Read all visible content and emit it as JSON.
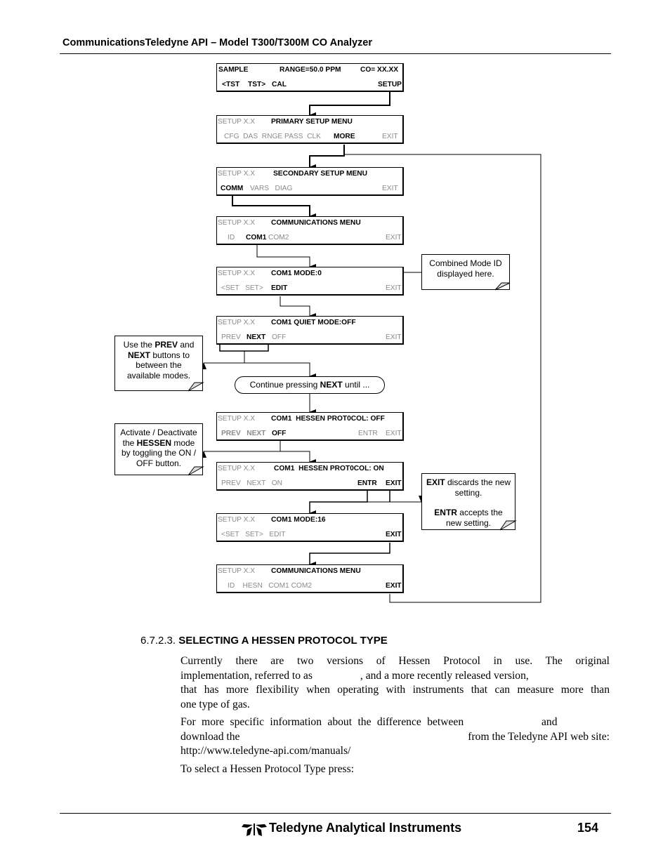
{
  "header": {
    "title": "CommunicationsTeledyne API – Model T300/T300M CO Analyzer"
  },
  "screens": [
    {
      "id": "sample",
      "line1": [
        {
          "t": "SAMPLE",
          "s": "b"
        },
        {
          "t": "RANGE=50.0 PPM",
          "s": "b"
        },
        {
          "t": "CO= XX.XX",
          "s": "b"
        }
      ],
      "line2": [
        {
          "t": "<TST",
          "s": "b"
        },
        {
          "t": "TST>",
          "s": "b"
        },
        {
          "t": "CAL",
          "s": "b"
        },
        {
          "t": "SETUP",
          "s": "b"
        }
      ]
    },
    {
      "id": "primary-setup",
      "line1": [
        {
          "t": "SETUP X.X",
          "s": "g"
        },
        {
          "t": "PRIMARY SETUP MENU",
          "s": "b"
        }
      ],
      "line2": [
        {
          "t": "CFG  DAS  RNGE PASS  CLK",
          "s": "g"
        },
        {
          "t": "MORE",
          "s": "b"
        },
        {
          "t": "EXIT",
          "s": "g"
        }
      ]
    },
    {
      "id": "secondary-setup",
      "line1": [
        {
          "t": "SETUP X.X",
          "s": "g"
        },
        {
          "t": "SECONDARY SETUP MENU",
          "s": "b"
        }
      ],
      "line2": [
        {
          "t": "COMM",
          "s": "b"
        },
        {
          "t": "VARS   DIAG",
          "s": "g"
        },
        {
          "t": "EXIT",
          "s": "g"
        }
      ]
    },
    {
      "id": "communications-menu",
      "line1": [
        {
          "t": "SETUP X.X",
          "s": "g"
        },
        {
          "t": "COMMUNICATIONS MENU",
          "s": "b"
        }
      ],
      "line2": [
        {
          "t": "ID",
          "s": "g"
        },
        {
          "t": "COM1",
          "s": "b"
        },
        {
          "t": "COM2",
          "s": "g"
        },
        {
          "t": "EXIT",
          "s": "g"
        }
      ]
    },
    {
      "id": "com1-mode-0",
      "line1": [
        {
          "t": "SETUP X.X",
          "s": "g"
        },
        {
          "t": "COM1 MODE:0",
          "s": "b"
        }
      ],
      "line2": [
        {
          "t": "<SET   SET>",
          "s": "g"
        },
        {
          "t": "EDIT",
          "s": "b"
        },
        {
          "t": "EXIT",
          "s": "g"
        }
      ]
    },
    {
      "id": "com1-quiet-mode",
      "line1": [
        {
          "t": "SETUP X.X",
          "s": "g"
        },
        {
          "t": "COM1 QUIET MODE:OFF",
          "s": "b"
        }
      ],
      "line2": [
        {
          "t": "PREV",
          "s": "g"
        },
        {
          "t": "NEXT",
          "s": "b"
        },
        {
          "t": "OFF",
          "s": "g"
        },
        {
          "t": "EXIT",
          "s": "g"
        }
      ]
    },
    {
      "id": "hessen-off",
      "line1": [
        {
          "t": "SETUP X.X",
          "s": "g"
        },
        {
          "t": "COM1  HESSEN PROT0COL: OFF",
          "s": "b"
        }
      ],
      "line2": [
        {
          "t": "PREV   NEXT",
          "s": "g"
        },
        {
          "t": "OFF",
          "s": "b"
        },
        {
          "t": "ENTR",
          "s": "g"
        },
        {
          "t": "EXIT",
          "s": "g"
        }
      ]
    },
    {
      "id": "hessen-on",
      "line1": [
        {
          "t": "SETUP X.X",
          "s": "g"
        },
        {
          "t": "COM1  HESSEN PROT0COL: ON",
          "s": "b"
        }
      ],
      "line2": [
        {
          "t": "PREV   NEXT   ON",
          "s": "g"
        },
        {
          "t": "ENTR",
          "s": "b"
        },
        {
          "t": "EXIT",
          "s": "b"
        }
      ]
    },
    {
      "id": "com1-mode-16",
      "line1": [
        {
          "t": "SETUP X.X",
          "s": "g"
        },
        {
          "t": "COM1 MODE:16",
          "s": "b"
        }
      ],
      "line2": [
        {
          "t": "<SET   SET>   EDIT",
          "s": "g"
        },
        {
          "t": "EXIT",
          "s": "b"
        }
      ]
    },
    {
      "id": "communications-menu-final",
      "line1": [
        {
          "t": "SETUP X.X",
          "s": "g"
        },
        {
          "t": "COMMUNICATIONS MENU",
          "s": "b"
        }
      ],
      "line2": [
        {
          "t": "ID    HESN   COM1 COM2",
          "s": "g"
        },
        {
          "t": "EXIT",
          "s": "b"
        }
      ]
    }
  ],
  "notes": {
    "combined_mode": [
      "Combined Mode ID",
      "displayed here."
    ],
    "prev_next": [
      [
        {
          "t": "Use the ",
          "b": false
        },
        {
          "t": "PREV",
          "b": true
        },
        {
          "t": " and",
          "b": false
        }
      ],
      [
        {
          "t": "NEXT",
          "b": true
        },
        {
          "t": " buttons to",
          "b": false
        }
      ],
      [
        {
          "t": "between the",
          "b": false
        }
      ],
      [
        {
          "t": "available modes.",
          "b": false
        }
      ]
    ],
    "hessen_toggle": [
      [
        {
          "t": "Activate / Deactivate",
          "b": false
        }
      ],
      [
        {
          "t": "the ",
          "b": false
        },
        {
          "t": "HESSEN",
          "b": true
        },
        {
          "t": " mode",
          "b": false
        }
      ],
      [
        {
          "t": "by toggling the ON /",
          "b": false
        }
      ],
      [
        {
          "t": "OFF button.",
          "b": false
        }
      ]
    ],
    "exit_entr": [
      [
        {
          "t": "EXIT",
          "b": true
        },
        {
          "t": " discards the new",
          "b": false
        }
      ],
      [
        {
          "t": "setting.",
          "b": false
        }
      ],
      [
        {
          "t": "",
          "b": false
        }
      ],
      [
        {
          "t": "ENTR",
          "b": true
        },
        {
          "t": " accepts the",
          "b": false
        }
      ],
      [
        {
          "t": "new setting.",
          "b": false
        }
      ]
    ],
    "continue": [
      {
        "t": "Continue pressing ",
        "b": false
      },
      {
        "t": "NEXT",
        "b": true
      },
      {
        "t": " until ...",
        "b": false
      }
    ]
  },
  "section": {
    "number": "6.7.2.3.",
    "title": "SELECTING A HESSEN PROTOCOL TYPE",
    "para1_line1": "Currently there are two versions of Hessen Protocol in use.  The original",
    "para1_line2a": "implementation, referred to as",
    "para1_line2b": ", and a more recently released version,",
    "para1_line3": "that has more flexibility when operating with instruments that can measure more than",
    "para1_line4": "one type of gas.",
    "para2_line1a": "For more specific information about the difference between",
    "para2_line1b": "and",
    "para2_line2a": "download the",
    "para2_line2b": "from the Teledyne API web site:",
    "para2_line3": "http://www.teledyne-api.com/manuals/",
    "para3": "To select a Hessen Protocol Type press:"
  },
  "footer": {
    "company": "Teledyne Analytical Instruments",
    "page": "154"
  }
}
